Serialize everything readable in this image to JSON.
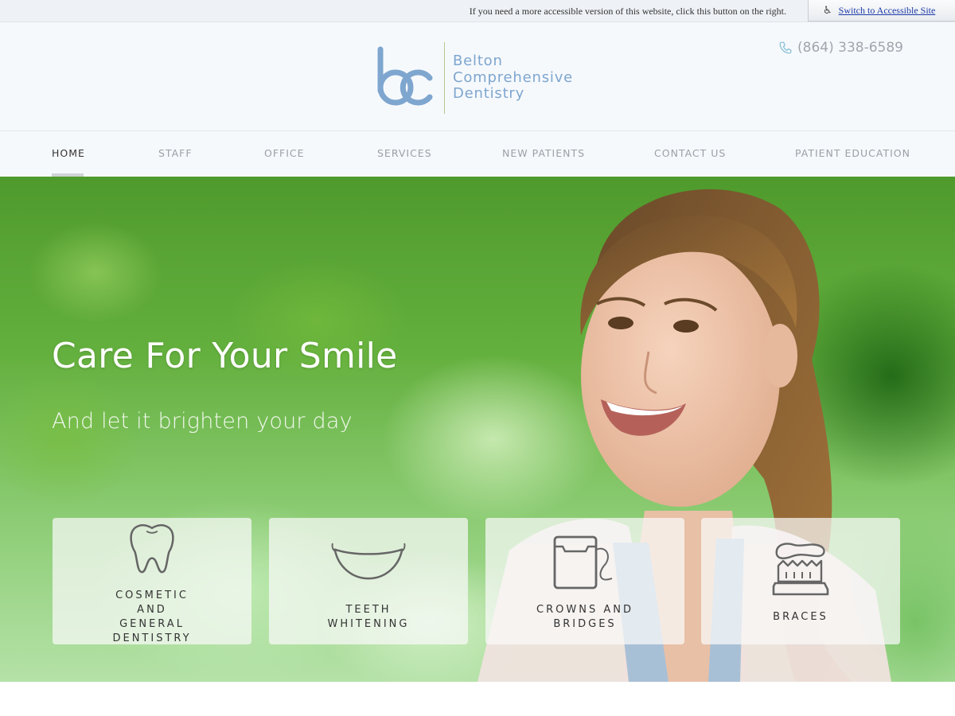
{
  "accessibility_bar": {
    "message": "If you need a more accessible version of this website, click this button on the right.",
    "button_label": "Switch to Accessible Site",
    "button_icon": "wheelchair-icon"
  },
  "header": {
    "logo_monogram": "bc",
    "logo_lines": [
      "Belton",
      "Comprehensive",
      "Dentistry"
    ],
    "phone_icon": "phone-icon",
    "phone": "(864) 338-6589"
  },
  "nav": {
    "items": [
      {
        "label": "HOME",
        "active": true
      },
      {
        "label": "STAFF",
        "active": false
      },
      {
        "label": "OFFICE",
        "active": false
      },
      {
        "label": "SERVICES",
        "active": false
      },
      {
        "label": "NEW PATIENTS",
        "active": false
      },
      {
        "label": "CONTACT US",
        "active": false
      },
      {
        "label": "PATIENT EDUCATION",
        "active": false
      }
    ]
  },
  "hero": {
    "title": "Care For Your Smile",
    "subtitle": "And let it brighten your day"
  },
  "services": [
    {
      "icon": "tooth-icon",
      "lines": [
        "COSMETIC",
        "AND",
        "GENERAL",
        "DENTISTRY"
      ]
    },
    {
      "icon": "smile-icon",
      "lines": [
        "TEETH",
        "WHITENING"
      ]
    },
    {
      "icon": "floss-icon",
      "lines": [
        "CROWNS AND",
        "BRIDGES"
      ]
    },
    {
      "icon": "toothbrush-icon",
      "lines": [
        "BRACES"
      ]
    }
  ],
  "colors": {
    "brand_blue": "#7ea6cf",
    "divider_green": "#b8c78a",
    "nav_active": "#333333",
    "nav_inactive": "#9aa0a6",
    "link_blue": "#1f3aa8"
  }
}
